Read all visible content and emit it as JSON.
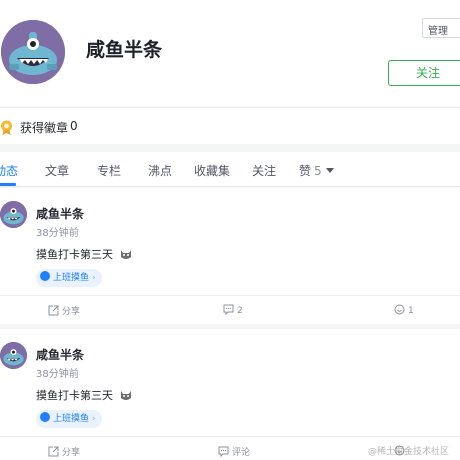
{
  "profile": {
    "username": "咸鱼半条",
    "manage_label": "管理",
    "follow_label": "关注"
  },
  "badges": {
    "label": "获得徽章",
    "count": "0"
  },
  "tabs": [
    {
      "label": "动态"
    },
    {
      "label": "文章"
    },
    {
      "label": "专栏"
    },
    {
      "label": "沸点"
    },
    {
      "label": "收藏集"
    },
    {
      "label": "关注"
    },
    {
      "label": "赞",
      "count": "5"
    }
  ],
  "posts": [
    {
      "author": "咸鱼半条",
      "time": "38分钟前",
      "content": "摸鱼打卡第三天",
      "topic": "上班摸鱼",
      "share_label": "分享",
      "comment_count": "2",
      "like_count": "1"
    },
    {
      "author": "咸鱼半条",
      "time": "38分钟前",
      "content": "摸鱼打卡第三天",
      "topic": "上班摸鱼",
      "share_label": "分享",
      "comment_label": "评论"
    }
  ],
  "watermark": "@稀土掘金技术社区",
  "colors": {
    "accent": "#1e80ff",
    "follow_green": "#37ac55",
    "avatar_bg": "#7f6ea6"
  }
}
